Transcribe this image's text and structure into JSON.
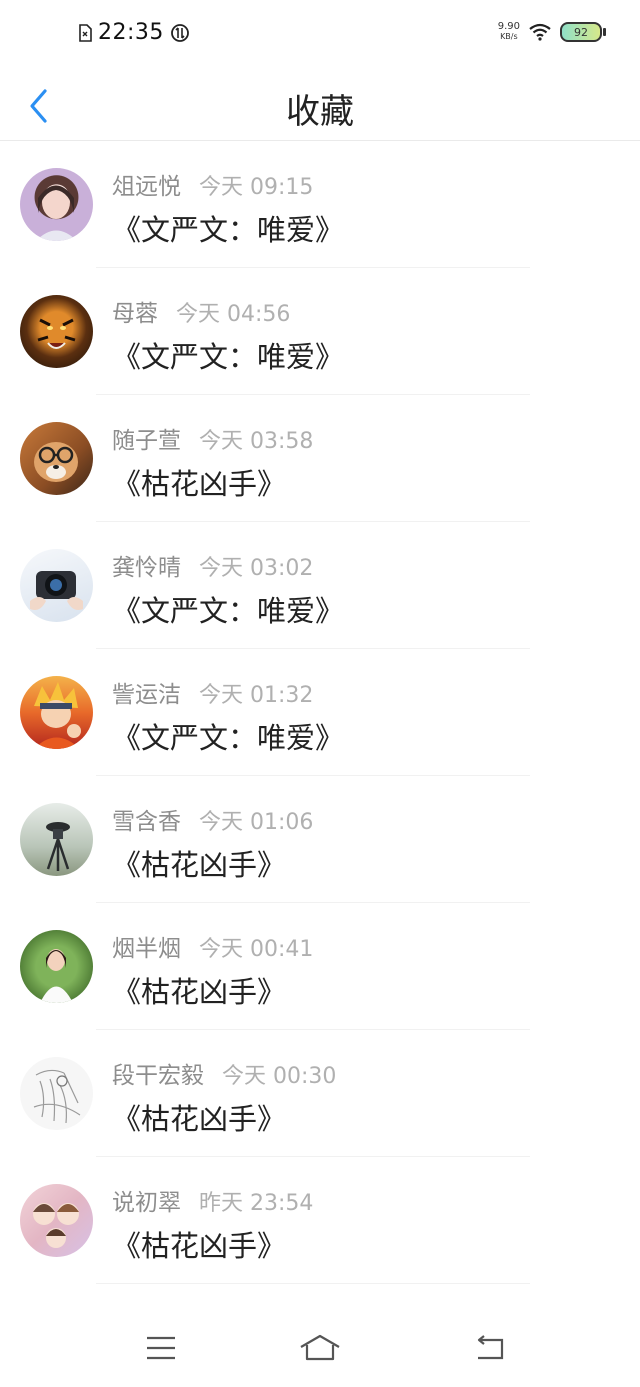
{
  "status": {
    "time": "22:35",
    "net_speed_value": "9.90",
    "net_speed_unit": "KB/s",
    "battery": "92"
  },
  "header": {
    "title": "收藏",
    "accent": "#2b8ff2"
  },
  "items": [
    {
      "name": "俎远悦",
      "time": "今天 09:15",
      "work": "《文严文：唯爱》",
      "avatar": "girl-portrait"
    },
    {
      "name": "母蓉",
      "time": "今天 04:56",
      "work": "《文严文：唯爱》",
      "avatar": "tiger"
    },
    {
      "name": "随子萱",
      "time": "今天 03:58",
      "work": "《枯花凶手》",
      "avatar": "dog-with-glasses"
    },
    {
      "name": "龚怜晴",
      "time": "今天 03:02",
      "work": "《文严文：唯爱》",
      "avatar": "camera"
    },
    {
      "name": "訾运洁",
      "time": "今天 01:32",
      "work": "《文严文：唯爱》",
      "avatar": "anime-character"
    },
    {
      "name": "雪含香",
      "time": "今天 01:06",
      "work": "《枯花凶手》",
      "avatar": "tripod-scene"
    },
    {
      "name": "烟半烟",
      "time": "今天 00:41",
      "work": "《枯花凶手》",
      "avatar": "girl-in-garden"
    },
    {
      "name": "段干宏毅",
      "time": "今天 00:30",
      "work": "《枯花凶手》",
      "avatar": "sketch-drawing"
    },
    {
      "name": "说初翠",
      "time": "昨天 23:54",
      "work": "《枯花凶手》",
      "avatar": "cartoon-kids"
    }
  ]
}
